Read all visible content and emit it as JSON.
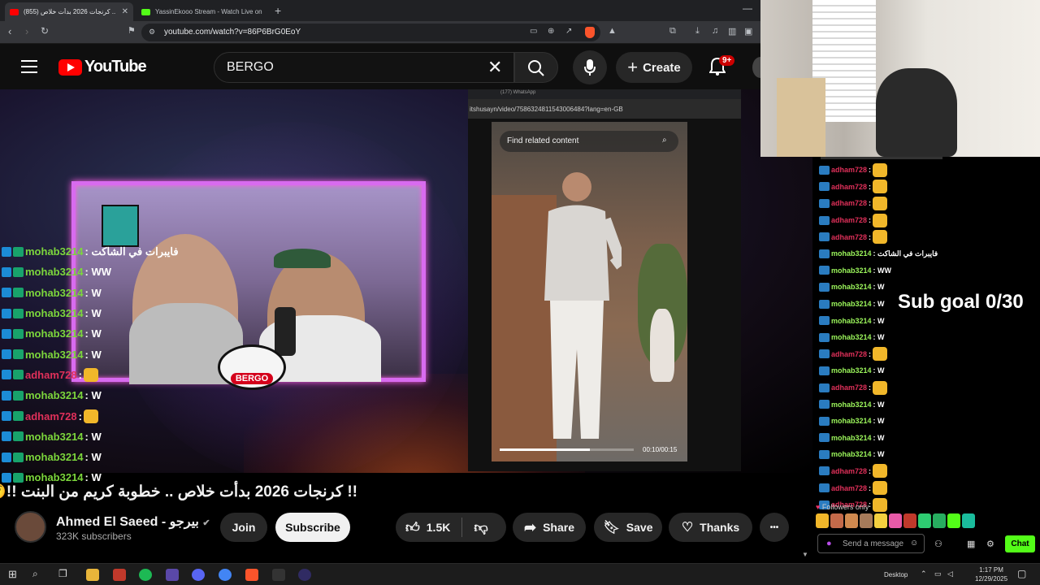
{
  "browser": {
    "tabs": [
      {
        "label": "(855) كرنجات 2026 بدأت خلاص ..",
        "active": true
      },
      {
        "label": "YassinEkooo Stream - Watch Live on",
        "active": false
      }
    ],
    "new_tab": "+",
    "minimize": "—",
    "address": "youtube.com/watch?v=86P6BrG0EoY"
  },
  "masthead": {
    "logo_text": "YouTube",
    "search_value": "BERGO",
    "create_label": "Create",
    "notification_badge": "9+"
  },
  "stream": {
    "bergo_tag": "BERGO",
    "shared_tab": "(177) WhatsApp",
    "shared_url": "itshusayn/video/7586324811543006484?lang=en-GB",
    "find_related": "Find related content",
    "tiktok_time": "00:10/00:15",
    "tiktok_progress": 0.67,
    "chat": [
      {
        "user": "mohab3214",
        "msg": ": فايبرات في الشاكت",
        "color": "#7cd63c"
      },
      {
        "user": "mohab3214",
        "msg": ": WW",
        "color": "#7cd63c"
      },
      {
        "user": "mohab3214",
        "msg": ": W",
        "color": "#7cd63c"
      },
      {
        "user": "mohab3214",
        "msg": ": W",
        "color": "#7cd63c"
      },
      {
        "user": "mohab3214",
        "msg": ": W",
        "color": "#7cd63c"
      },
      {
        "user": "mohab3214",
        "msg": ": W",
        "color": "#7cd63c"
      },
      {
        "user": "adham728",
        "msg": ":",
        "color": "#e0305a"
      },
      {
        "user": "mohab3214",
        "msg": ": W",
        "color": "#7cd63c"
      },
      {
        "user": "adham728",
        "msg": ":",
        "color": "#e0305a"
      },
      {
        "user": "mohab3214",
        "msg": ": W",
        "color": "#7cd63c"
      },
      {
        "user": "mohab3214",
        "msg": ": W",
        "color": "#7cd63c"
      },
      {
        "user": "mohab3214",
        "msg": ": W",
        "color": "#7cd63c"
      }
    ]
  },
  "video": {
    "title": "!! كرنجات 2026 بدأت خلاص .. خطوبة كريم من البنت !!😲",
    "owner": "Ahmed El Saeed - بيرجو",
    "subscribers": "323K subscribers",
    "join_label": "Join",
    "subscribe_label": "Subscribe",
    "likes": "1.5K",
    "share_label": "Share",
    "save_label": "Save",
    "thanks_label": "Thanks",
    "more": "•••"
  },
  "side_chat": {
    "lines": [
      {
        "user": "adham728",
        "msg": ":",
        "color": "#e0305a",
        "emote": true
      },
      {
        "user": "adham728",
        "msg": ":",
        "color": "#e0305a",
        "emote": true
      },
      {
        "user": "adham728",
        "msg": ":",
        "color": "#e0305a",
        "emote": true
      },
      {
        "user": "adham728",
        "msg": ":",
        "color": "#e0305a",
        "emote": true
      },
      {
        "user": "adham728",
        "msg": ":",
        "color": "#e0305a",
        "emote": true
      },
      {
        "user": "mohab3214",
        "msg": ": فايبرات في الشاكت",
        "color": "#9bf55b",
        "emote": false
      },
      {
        "user": "mohab3214",
        "msg": ": WW",
        "color": "#9bf55b",
        "emote": false
      },
      {
        "user": "mohab3214",
        "msg": ": W",
        "color": "#9bf55b",
        "emote": false
      },
      {
        "user": "mohab3214",
        "msg": ": W",
        "color": "#9bf55b",
        "emote": false
      },
      {
        "user": "mohab3214",
        "msg": ": W",
        "color": "#9bf55b",
        "emote": false
      },
      {
        "user": "mohab3214",
        "msg": ": W",
        "color": "#9bf55b",
        "emote": false
      },
      {
        "user": "adham728",
        "msg": ":",
        "color": "#e0305a",
        "emote": true
      },
      {
        "user": "mohab3214",
        "msg": ": W",
        "color": "#9bf55b",
        "emote": false
      },
      {
        "user": "adham728",
        "msg": ":",
        "color": "#e0305a",
        "emote": true
      },
      {
        "user": "mohab3214",
        "msg": ": W",
        "color": "#9bf55b",
        "emote": false
      },
      {
        "user": "mohab3214",
        "msg": ": W",
        "color": "#9bf55b",
        "emote": false
      },
      {
        "user": "mohab3214",
        "msg": ": W",
        "color": "#9bf55b",
        "emote": false
      },
      {
        "user": "mohab3214",
        "msg": ": W",
        "color": "#9bf55b",
        "emote": false
      },
      {
        "user": "adham728",
        "msg": ":",
        "color": "#e0305a",
        "emote": true
      },
      {
        "user": "adham728",
        "msg": ":",
        "color": "#e0305a",
        "emote": true
      },
      {
        "user": "adham728",
        "msg": ":",
        "color": "#e0305a",
        "emote": true
      }
    ],
    "sub_goal": "Sub goal 0/30",
    "followers_only": "Followers only",
    "input_placeholder": "Send a message",
    "chat_button": "Chat"
  },
  "taskbar": {
    "desktop_label": "Desktop",
    "time": "1:17 PM",
    "date": "12/29/2025"
  },
  "colors": {
    "youtube_red": "#ff0000",
    "kick_green": "#53fc18",
    "cam_border": "#d86bef"
  }
}
